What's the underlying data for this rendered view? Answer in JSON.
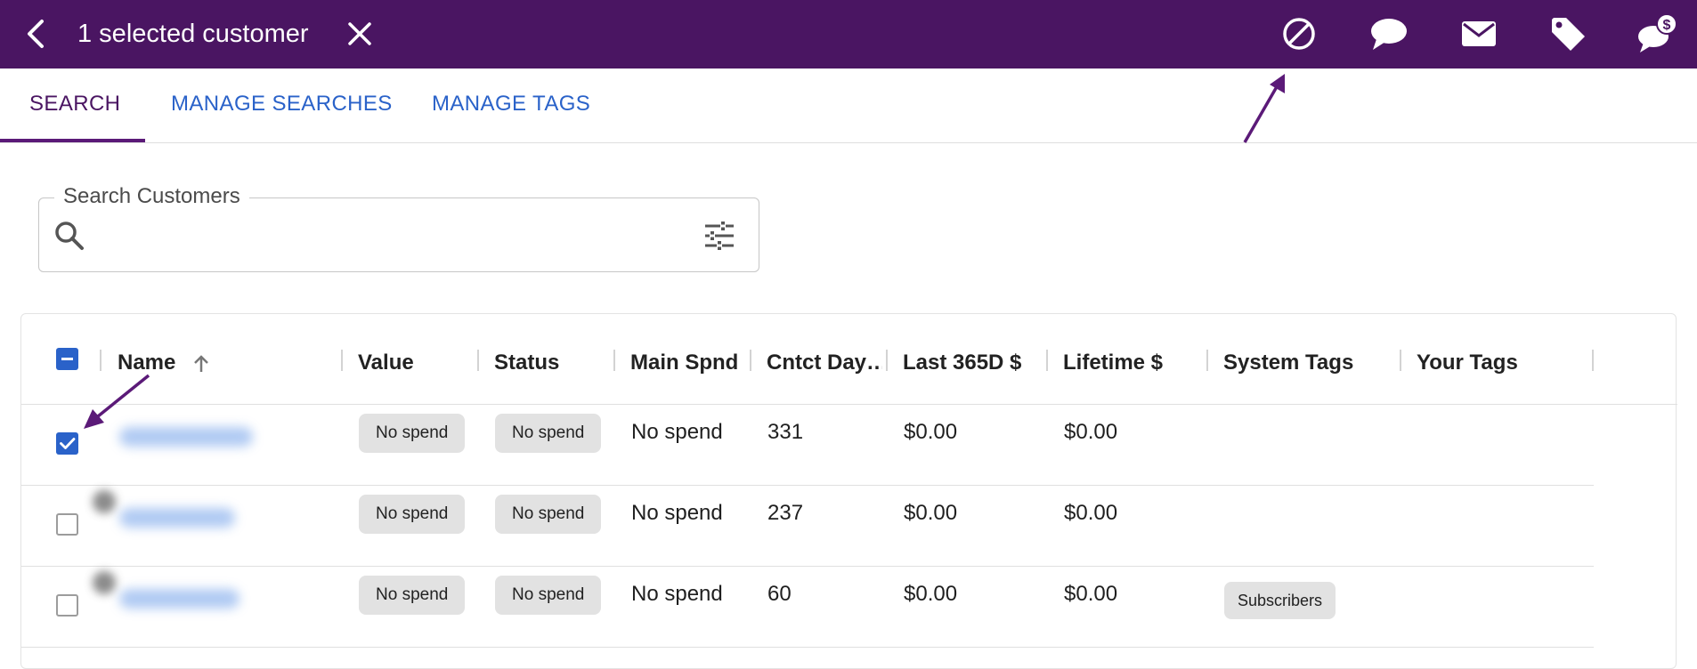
{
  "header": {
    "title": "1 selected customer",
    "actions": [
      "block-icon",
      "chat-bubble-icon",
      "mail-icon",
      "tag-icon",
      "chat-dollar-icon"
    ],
    "bg_color": "#4a1562"
  },
  "tabs": [
    {
      "label": "SEARCH",
      "active": true
    },
    {
      "label": "MANAGE SEARCHES",
      "active": false
    },
    {
      "label": "MANAGE TAGS",
      "active": false
    }
  ],
  "search": {
    "legend": "Search Customers",
    "value": "",
    "placeholder": ""
  },
  "table": {
    "columns": [
      "Name",
      "Value",
      "Status",
      "Main Spnd",
      "Cntct Day…",
      "Last 365D $",
      "Lifetime $",
      "System Tags",
      "Your Tags"
    ],
    "rows": [
      {
        "selected": true,
        "value": "No spend",
        "status": "No spend",
        "main_spend": "No spend",
        "contact_days": "331",
        "last_365": "$0.00",
        "lifetime": "$0.00",
        "system_tags": []
      },
      {
        "selected": false,
        "value": "No spend",
        "status": "No spend",
        "main_spend": "No spend",
        "contact_days": "237",
        "last_365": "$0.00",
        "lifetime": "$0.00",
        "system_tags": []
      },
      {
        "selected": false,
        "value": "No spend",
        "status": "No spend",
        "main_spend": "No spend",
        "contact_days": "60",
        "last_365": "$0.00",
        "lifetime": "$0.00",
        "system_tags": [
          "Subscribers"
        ]
      }
    ]
  },
  "colors": {
    "accent": "#2a62c9",
    "annotation": "#5b1a78",
    "chip_bg": "#e2e2e2"
  }
}
